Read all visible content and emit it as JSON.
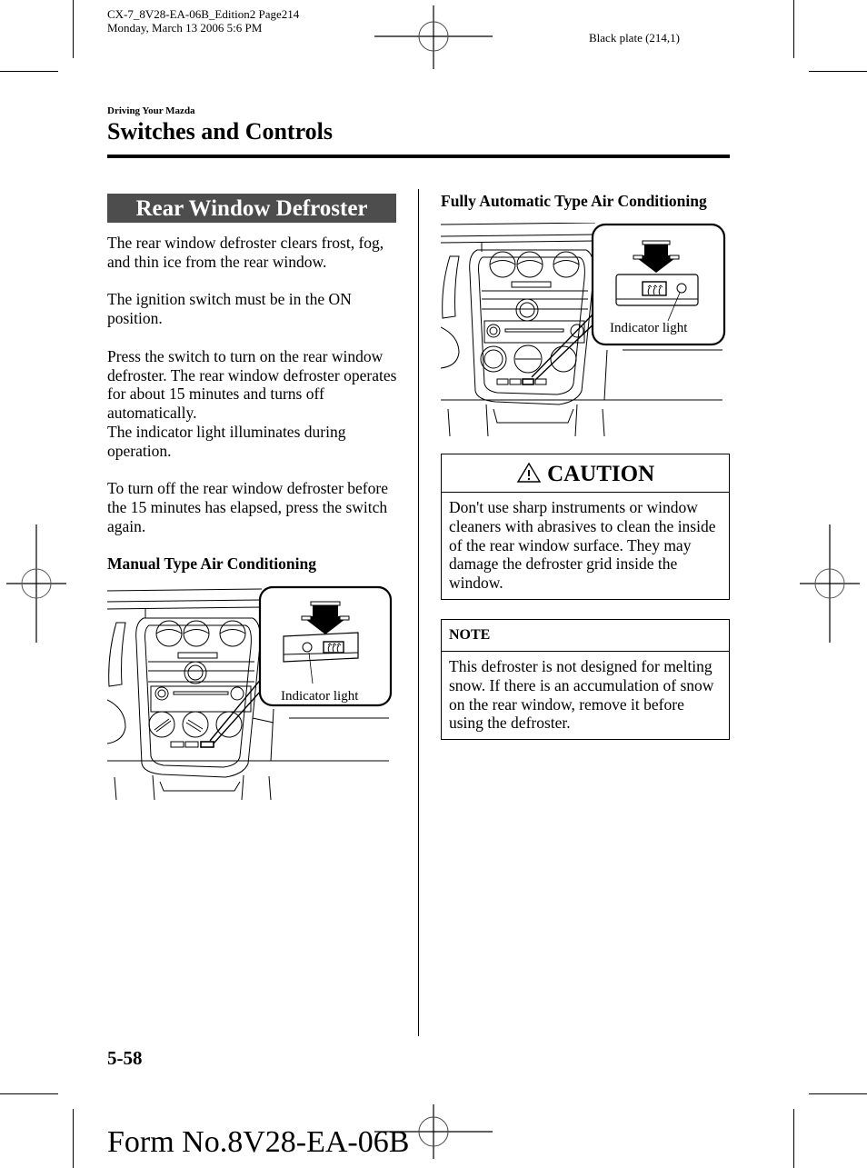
{
  "print_slug": {
    "file_line": "CX-7_8V28-EA-06B_Edition2 Page214",
    "date_line": "Monday, March 13 2006 5:6 PM",
    "plate": "Black plate (214,1)"
  },
  "header": {
    "section": "Driving Your Mazda",
    "title": "Switches and Controls"
  },
  "article": {
    "heading": "Rear Window Defroster",
    "paragraphs": [
      "The rear window defroster clears frost, fog, and thin ice from the rear window.",
      "The ignition switch must be in the ON position.",
      "Press the switch to turn on the rear window defroster. The rear window defroster operates for about 15 minutes and turns off automatically.",
      "The indicator light illuminates during operation.",
      "To turn off the rear window defroster before the 15 minutes has elapsed, press the switch again."
    ],
    "figures": [
      {
        "caption": "Manual Type Air Conditioning",
        "callout_label": "Indicator light",
        "icon": "rear-defroster-switch-icon"
      },
      {
        "caption": "Fully Automatic Type Air Conditioning",
        "callout_label": "Indicator light",
        "icon": "rear-defroster-switch-icon"
      }
    ]
  },
  "caution": {
    "icon": "warning-triangle-icon",
    "title": "CAUTION",
    "text": "Don't use sharp instruments or window cleaners with abrasives to clean the inside of the rear window surface. They may damage the defroster grid inside the window."
  },
  "note": {
    "title": "NOTE",
    "text": "This defroster is not designed for melting snow. If there is an accumulation of snow on the rear window, remove it before using the defroster."
  },
  "footer": {
    "page_number": "5-58",
    "form_number": "Form No.8V28-EA-06B"
  }
}
